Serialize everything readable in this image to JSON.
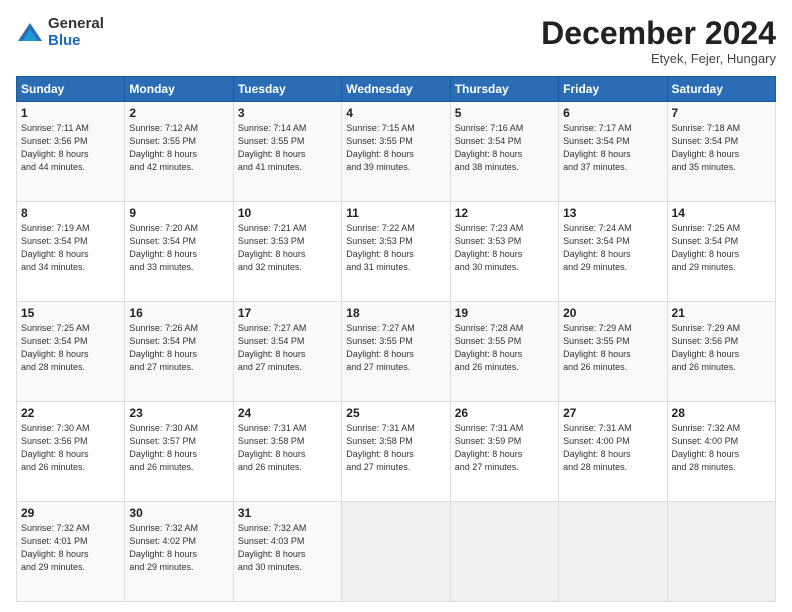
{
  "logo": {
    "general": "General",
    "blue": "Blue"
  },
  "header": {
    "month": "December 2024",
    "location": "Etyek, Fejer, Hungary"
  },
  "days_of_week": [
    "Sunday",
    "Monday",
    "Tuesday",
    "Wednesday",
    "Thursday",
    "Friday",
    "Saturday"
  ],
  "weeks": [
    [
      {
        "day": "1",
        "info": "Sunrise: 7:11 AM\nSunset: 3:56 PM\nDaylight: 8 hours\nand 44 minutes."
      },
      {
        "day": "2",
        "info": "Sunrise: 7:12 AM\nSunset: 3:55 PM\nDaylight: 8 hours\nand 42 minutes."
      },
      {
        "day": "3",
        "info": "Sunrise: 7:14 AM\nSunset: 3:55 PM\nDaylight: 8 hours\nand 41 minutes."
      },
      {
        "day": "4",
        "info": "Sunrise: 7:15 AM\nSunset: 3:55 PM\nDaylight: 8 hours\nand 39 minutes."
      },
      {
        "day": "5",
        "info": "Sunrise: 7:16 AM\nSunset: 3:54 PM\nDaylight: 8 hours\nand 38 minutes."
      },
      {
        "day": "6",
        "info": "Sunrise: 7:17 AM\nSunset: 3:54 PM\nDaylight: 8 hours\nand 37 minutes."
      },
      {
        "day": "7",
        "info": "Sunrise: 7:18 AM\nSunset: 3:54 PM\nDaylight: 8 hours\nand 35 minutes."
      }
    ],
    [
      {
        "day": "8",
        "info": "Sunrise: 7:19 AM\nSunset: 3:54 PM\nDaylight: 8 hours\nand 34 minutes."
      },
      {
        "day": "9",
        "info": "Sunrise: 7:20 AM\nSunset: 3:54 PM\nDaylight: 8 hours\nand 33 minutes."
      },
      {
        "day": "10",
        "info": "Sunrise: 7:21 AM\nSunset: 3:53 PM\nDaylight: 8 hours\nand 32 minutes."
      },
      {
        "day": "11",
        "info": "Sunrise: 7:22 AM\nSunset: 3:53 PM\nDaylight: 8 hours\nand 31 minutes."
      },
      {
        "day": "12",
        "info": "Sunrise: 7:23 AM\nSunset: 3:53 PM\nDaylight: 8 hours\nand 30 minutes."
      },
      {
        "day": "13",
        "info": "Sunrise: 7:24 AM\nSunset: 3:54 PM\nDaylight: 8 hours\nand 29 minutes."
      },
      {
        "day": "14",
        "info": "Sunrise: 7:25 AM\nSunset: 3:54 PM\nDaylight: 8 hours\nand 29 minutes."
      }
    ],
    [
      {
        "day": "15",
        "info": "Sunrise: 7:25 AM\nSunset: 3:54 PM\nDaylight: 8 hours\nand 28 minutes."
      },
      {
        "day": "16",
        "info": "Sunrise: 7:26 AM\nSunset: 3:54 PM\nDaylight: 8 hours\nand 27 minutes."
      },
      {
        "day": "17",
        "info": "Sunrise: 7:27 AM\nSunset: 3:54 PM\nDaylight: 8 hours\nand 27 minutes."
      },
      {
        "day": "18",
        "info": "Sunrise: 7:27 AM\nSunset: 3:55 PM\nDaylight: 8 hours\nand 27 minutes."
      },
      {
        "day": "19",
        "info": "Sunrise: 7:28 AM\nSunset: 3:55 PM\nDaylight: 8 hours\nand 26 minutes."
      },
      {
        "day": "20",
        "info": "Sunrise: 7:29 AM\nSunset: 3:55 PM\nDaylight: 8 hours\nand 26 minutes."
      },
      {
        "day": "21",
        "info": "Sunrise: 7:29 AM\nSunset: 3:56 PM\nDaylight: 8 hours\nand 26 minutes."
      }
    ],
    [
      {
        "day": "22",
        "info": "Sunrise: 7:30 AM\nSunset: 3:56 PM\nDaylight: 8 hours\nand 26 minutes."
      },
      {
        "day": "23",
        "info": "Sunrise: 7:30 AM\nSunset: 3:57 PM\nDaylight: 8 hours\nand 26 minutes."
      },
      {
        "day": "24",
        "info": "Sunrise: 7:31 AM\nSunset: 3:58 PM\nDaylight: 8 hours\nand 26 minutes."
      },
      {
        "day": "25",
        "info": "Sunrise: 7:31 AM\nSunset: 3:58 PM\nDaylight: 8 hours\nand 27 minutes."
      },
      {
        "day": "26",
        "info": "Sunrise: 7:31 AM\nSunset: 3:59 PM\nDaylight: 8 hours\nand 27 minutes."
      },
      {
        "day": "27",
        "info": "Sunrise: 7:31 AM\nSunset: 4:00 PM\nDaylight: 8 hours\nand 28 minutes."
      },
      {
        "day": "28",
        "info": "Sunrise: 7:32 AM\nSunset: 4:00 PM\nDaylight: 8 hours\nand 28 minutes."
      }
    ],
    [
      {
        "day": "29",
        "info": "Sunrise: 7:32 AM\nSunset: 4:01 PM\nDaylight: 8 hours\nand 29 minutes."
      },
      {
        "day": "30",
        "info": "Sunrise: 7:32 AM\nSunset: 4:02 PM\nDaylight: 8 hours\nand 29 minutes."
      },
      {
        "day": "31",
        "info": "Sunrise: 7:32 AM\nSunset: 4:03 PM\nDaylight: 8 hours\nand 30 minutes."
      },
      {
        "day": "",
        "info": ""
      },
      {
        "day": "",
        "info": ""
      },
      {
        "day": "",
        "info": ""
      },
      {
        "day": "",
        "info": ""
      }
    ]
  ]
}
